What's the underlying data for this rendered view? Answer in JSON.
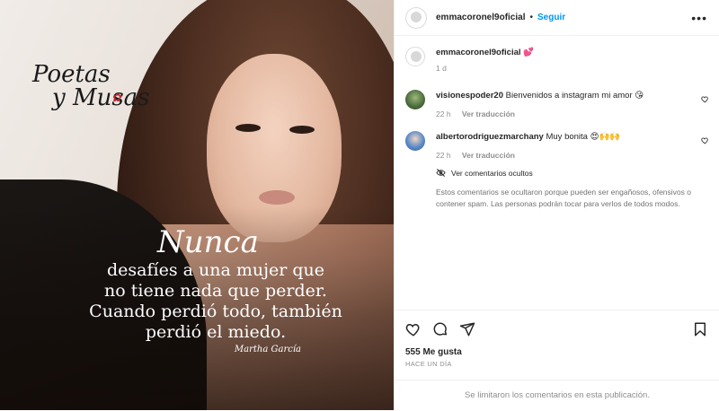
{
  "image": {
    "brand_top": "Poetas",
    "brand_bottom": "y Musas",
    "quote_lead": "Nunca",
    "quote_lines": [
      "desafíes a una mujer que",
      "no tiene nada que perder.",
      "Cuando perdió todo, también",
      "perdió el miedo."
    ],
    "quote_author": "Martha García"
  },
  "header": {
    "username": "emmacoronel9oficial",
    "separator": "•",
    "follow_label": "Seguir",
    "more_icon": "more-horizontal-icon"
  },
  "caption": {
    "username": "emmacoronel9oficial",
    "text": "💕",
    "time": "1 d"
  },
  "comments": [
    {
      "username": "visionespoder20",
      "text": "Bienvenidos a instagram mi amor 😘",
      "time": "22 h",
      "translate_label": "Ver traducción"
    },
    {
      "username": "albertorodriguezmarchany",
      "text": "Muy bonita 😍🙌🙌",
      "time": "22 h",
      "translate_label": "Ver traducción"
    }
  ],
  "hidden": {
    "link_label": "Ver comentarios ocultos",
    "note": "Estos comentarios se ocultaron porque pueden ser engañosos, ofensivos o contener spam. Las personas podrán tocar para verlos de todos modos."
  },
  "actions": {
    "likes": "555 Me gusta",
    "posted": "HACE UN DÍA"
  },
  "footer": {
    "limited": "Se limitaron los comentarios en esta publicación."
  },
  "colors": {
    "accent": "#0095f6",
    "muted": "#8e8e8e",
    "text": "#262626"
  }
}
